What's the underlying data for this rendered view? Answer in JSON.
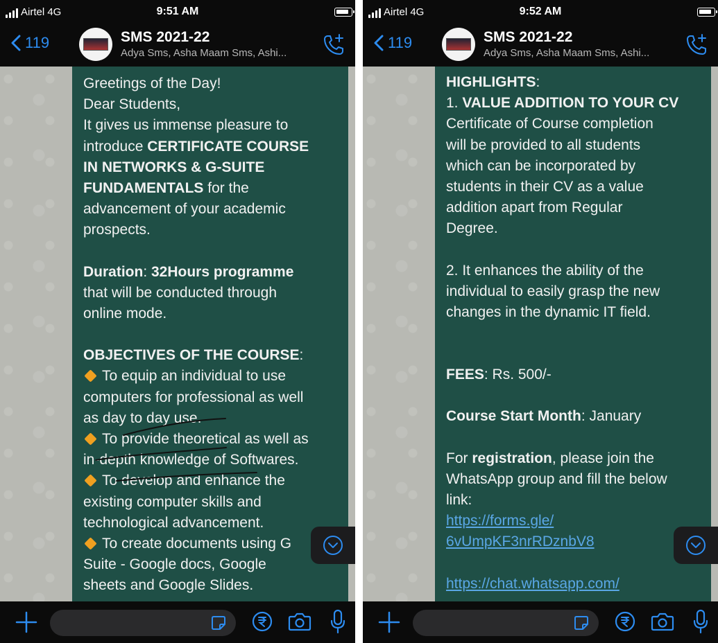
{
  "colors": {
    "accent": "#2d8cf0",
    "bubble": "#1f4f46",
    "link": "#5aa7e6",
    "chat_bg": "#b8b9b3"
  },
  "left": {
    "status": {
      "carrier": "Airtel  4G",
      "time": "9:51 AM"
    },
    "header": {
      "back_count": "119",
      "title": "SMS 2021-22",
      "subtitle": "Adya Sms, Asha Maam Sms, Ashi..."
    },
    "message": {
      "l1": "Greetings of the Day!",
      "l2": "Dear Students,",
      "l3": "It gives us immense pleasure to",
      "l4a": "introduce ",
      "l4b": "CERTIFICATE COURSE",
      "l5": "IN NETWORKS & G-SUITE",
      "l6a": "FUNDAMENTALS",
      "l6b": " for the",
      "l7": "advancement of your academic",
      "l8": "prospects.",
      "l9a": "Duration",
      "l9b": ": ",
      "l9c": "32Hours programme",
      "l10": "that will be conducted through",
      "l11": "online mode.",
      "l12a": "OBJECTIVES OF THE COURSE",
      "l12b": ":",
      "l13": "To equip an individual to use",
      "l14": "computers for professional as well",
      "l15": "as day to day use.",
      "l16": "To provide theoretical as well as",
      "l17": "in-depth knowledge of Softwares.",
      "l18": "To develop and enhance the",
      "l19": "existing computer skills and",
      "l20": "technological advancement.",
      "l21": "To create documents using G",
      "l22": "Suite - Google docs, Google",
      "l23": "sheets and Google Slides."
    }
  },
  "right": {
    "status": {
      "carrier": "Airtel  4G",
      "time": "9:52 AM"
    },
    "header": {
      "back_count": "119",
      "title": "SMS 2021-22",
      "subtitle": "Adya Sms, Asha Maam Sms, Ashi..."
    },
    "message": {
      "r1a": "HIGHLIGHTS",
      "r1b": ":",
      "r2a": "1. ",
      "r2b": "VALUE ADDITION TO YOUR CV",
      "r3": "Certificate of Course completion",
      "r4": "will be provided to all students",
      "r5": "which can be incorporated by",
      "r6": "students in their CV as a value",
      "r7": "addition apart from Regular",
      "r8": "Degree.",
      "r9": "2. It enhances the ability of the",
      "r10": "individual to easily grasp the new",
      "r11": "changes in the dynamic IT field.",
      "r12a": "FEES",
      "r12b": ": Rs. 500/-",
      "r13a": "Course Start Month",
      "r13b": ": January",
      "r14a": "For ",
      "r14b": "registration",
      "r14c": ", please join the",
      "r15": "WhatsApp group and fill the below",
      "r16": "link:",
      "r17": "https://forms.gle/",
      "r18": "6vUmpKF3nrRDznbV8",
      "r19": "https://chat.whatsapp.com/"
    }
  }
}
